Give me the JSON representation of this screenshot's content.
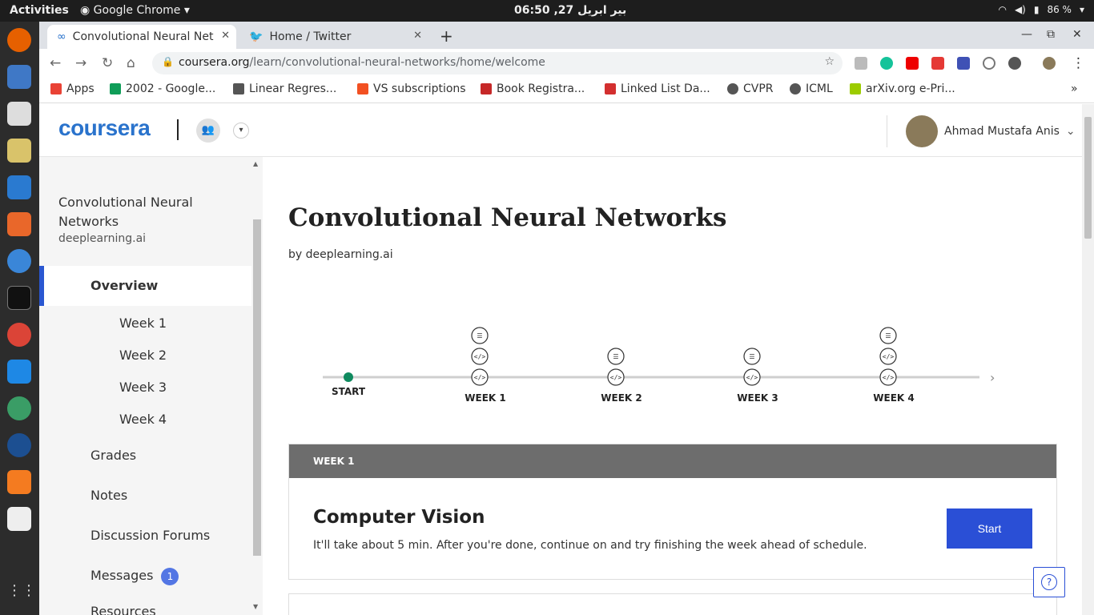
{
  "topbar": {
    "activities": "Activities",
    "app_name": "Google Chrome",
    "clock": "بير ابريل 27, 06:50",
    "battery": "86 %"
  },
  "browser": {
    "tabs": [
      {
        "title": "Convolutional Neural Net",
        "icon": "coursera-icon"
      },
      {
        "title": "Home / Twitter",
        "icon": "twitter-icon"
      }
    ],
    "url_host": "coursera.org",
    "url_path": "/learn/convolutional-neural-networks/home/welcome",
    "bookmarks": [
      {
        "label": "Apps",
        "color": "#e94235"
      },
      {
        "label": "2002 - Google...",
        "color": "#0f9d58"
      },
      {
        "label": "Linear Regres...",
        "color": "#555555"
      },
      {
        "label": "VS subscriptions",
        "color": "#f25022"
      },
      {
        "label": "Book Registra...",
        "color": "#c62828"
      },
      {
        "label": "Linked List Da...",
        "color": "#d32f2f"
      },
      {
        "label": "CVPR",
        "color": "#555555"
      },
      {
        "label": "ICML",
        "color": "#555555"
      },
      {
        "label": "arXiv.org e-Pri...",
        "color": "#9ccc00"
      }
    ]
  },
  "header": {
    "logo": "coursera",
    "user_name": "Ahmad Mustafa Anis"
  },
  "sidebar": {
    "course_title": "Convolutional Neural Networks",
    "org": "deeplearning.ai",
    "overview": "Overview",
    "weeks": [
      "Week 1",
      "Week 2",
      "Week 3",
      "Week 4"
    ],
    "items": [
      {
        "label": "Grades"
      },
      {
        "label": "Notes"
      },
      {
        "label": "Discussion Forums"
      },
      {
        "label": "Messages",
        "badge": "1"
      },
      {
        "label": "Resources"
      }
    ]
  },
  "main": {
    "title": "Convolutional Neural Networks",
    "byline": "by deeplearning.ai",
    "timeline": {
      "start_label": "START",
      "weeks": [
        {
          "label": "WEEK 1",
          "icons": [
            "reading",
            "code",
            "code"
          ]
        },
        {
          "label": "WEEK 2",
          "icons": [
            "reading",
            "code"
          ]
        },
        {
          "label": "WEEK 3",
          "icons": [
            "reading",
            "code"
          ]
        },
        {
          "label": "WEEK 4",
          "icons": [
            "reading",
            "code",
            "code"
          ]
        }
      ]
    },
    "card": {
      "header": "WEEK 1",
      "title": "Computer Vision",
      "description": "It'll take about 5 min. After you're done, continue on and try finishing the week ahead of schedule.",
      "button": "Start"
    },
    "help": "?"
  },
  "colors": {
    "accent": "#2a4fd6",
    "coursera_blue": "#2a73cc",
    "timeline_green": "#0f8a5f"
  }
}
